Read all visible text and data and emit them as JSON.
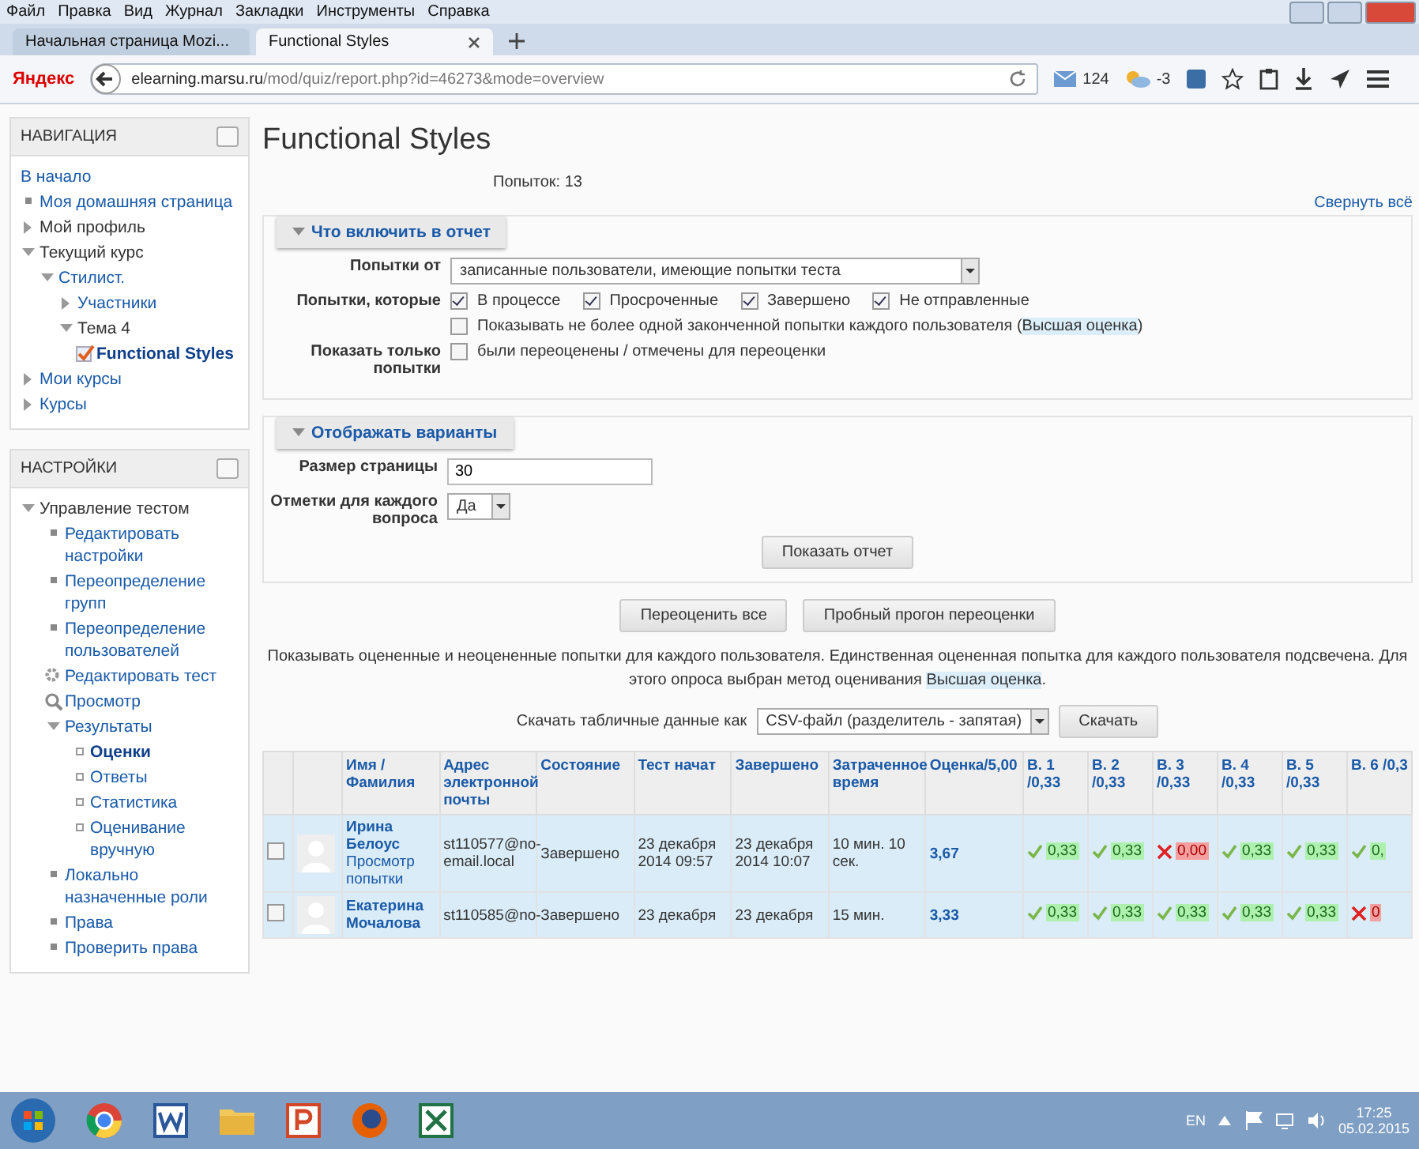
{
  "browser": {
    "menu": [
      "Файл",
      "Правка",
      "Вид",
      "Журнал",
      "Закладки",
      "Инструменты",
      "Справка"
    ],
    "tabs": [
      {
        "title": "Начальная страница Mozi...",
        "selected": false
      },
      {
        "title": "Functional Styles",
        "selected": true
      }
    ],
    "search_engine": "Яндекс",
    "url_host": "elearning.marsu.ru",
    "url_path": "/mod/quiz/report.php?id=46273&mode=overview",
    "mail_count": "124",
    "weather": "-3"
  },
  "navigation": {
    "title": "НАВИГАЦИЯ",
    "items": [
      {
        "label": "В начало",
        "kind": "none",
        "link": true,
        "selected": false
      },
      {
        "label": "Моя домашняя страница",
        "kind": "bullet",
        "link": true,
        "selected": false
      },
      {
        "label": "Мой профиль",
        "kind": "arrow",
        "expanded": false,
        "link": false,
        "selected": false
      },
      {
        "label": "Текущий курс",
        "kind": "arrow",
        "expanded": true,
        "link": false,
        "selected": false,
        "children": [
          {
            "label": "Стилист.",
            "kind": "arrow",
            "expanded": true,
            "link": true,
            "selected": false,
            "children": [
              {
                "label": "Участники",
                "kind": "arrow",
                "expanded": false,
                "link": true,
                "selected": false
              },
              {
                "label": "Тема 4",
                "kind": "arrow",
                "expanded": true,
                "link": false,
                "selected": false,
                "children": [
                  {
                    "label": "Functional Styles",
                    "kind": "quiz",
                    "link": true,
                    "selected": true
                  }
                ]
              }
            ]
          }
        ]
      },
      {
        "label": "Мои курсы",
        "kind": "arrow",
        "expanded": false,
        "link": true,
        "selected": false
      },
      {
        "label": "Курсы",
        "kind": "arrow",
        "expanded": false,
        "link": true,
        "selected": false
      }
    ]
  },
  "settings": {
    "title": "НАСТРОЙКИ",
    "items": [
      {
        "label": "Управление тестом",
        "kind": "arrow",
        "expanded": true,
        "link": false,
        "selected": false,
        "children": [
          {
            "label": "Редактировать настройки",
            "kind": "bullet",
            "link": true,
            "selected": false
          },
          {
            "label": "Переопределение групп",
            "kind": "bullet",
            "link": true,
            "selected": false
          },
          {
            "label": "Переопределение пользователей",
            "kind": "bullet",
            "link": true,
            "selected": false
          },
          {
            "label": "Редактировать тест",
            "kind": "gear",
            "link": true,
            "selected": false
          },
          {
            "label": "Просмотр",
            "kind": "search",
            "link": true,
            "selected": false
          },
          {
            "label": "Результаты",
            "kind": "arrow",
            "expanded": true,
            "link": true,
            "selected": false,
            "children": [
              {
                "label": "Оценки",
                "kind": "square",
                "link": true,
                "selected": true
              },
              {
                "label": "Ответы",
                "kind": "square",
                "link": true,
                "selected": false
              },
              {
                "label": "Статистика",
                "kind": "square",
                "link": true,
                "selected": false
              },
              {
                "label": "Оценивание вручную",
                "kind": "square",
                "link": true,
                "selected": false
              }
            ]
          },
          {
            "label": "Локально назначенные роли",
            "kind": "bullet",
            "link": true,
            "selected": false
          },
          {
            "label": "Права",
            "kind": "bullet",
            "link": true,
            "selected": false
          },
          {
            "label": "Проверить права",
            "kind": "bullet",
            "link": true,
            "selected": false
          }
        ]
      }
    ]
  },
  "page_title": "Functional Styles",
  "attempts_count": "Попыток: 13",
  "collapse_all": "Свернуть всё",
  "report_section": {
    "title": "Что включить в отчет",
    "expanded": true,
    "attempts_from": {
      "label": "Попытки от",
      "value": "записанные пользователи, имеющие попытки теста"
    },
    "attempts_which": {
      "label": "Попытки, которые",
      "options": [
        {
          "label": "В процессе",
          "checked": true
        },
        {
          "label": "Просроченные",
          "checked": true
        },
        {
          "label": "Завершено",
          "checked": true
        },
        {
          "label": "Не отправленные",
          "checked": true
        }
      ]
    },
    "only_one": {
      "checked": false,
      "text": "Показывать не более одной законченной попытки каждого пользователя (",
      "highlight": "Высшая оценка",
      "after": ")"
    },
    "show_only": {
      "label": "Показать только попытки",
      "checked": false,
      "text": "были переоценены / отмечены для переоценки"
    }
  },
  "display_section": {
    "title": "Отображать варианты",
    "expanded": true,
    "page_size": {
      "label": "Размер страницы",
      "value": "30"
    },
    "marks": {
      "label": "Отметки для каждого вопроса",
      "value": "Да"
    },
    "submit": "Показать отчет"
  },
  "actions": [
    "Переоценить все",
    "Пробный прогон переоценки"
  ],
  "info": {
    "text": "Показывать оцененные и неоцененные попытки для каждого пользователя. Единственная оцененная попытка для каждого пользователя подсвечена. Для этого опроса выбран метод оценивания ",
    "highlight": "Высшая оценка",
    "after": "."
  },
  "download": {
    "label": "Скачать табличные данные как",
    "format": "CSV-файл (разделитель - запятая)",
    "button": "Скачать"
  },
  "table": {
    "columns": [
      "Имя / Фамилия",
      "Адрес электронной почты",
      "Состояние",
      "Тест начат",
      "Завершено",
      "Затраченное время",
      "Оценка/5,00",
      "В. 1 /0,33",
      "В. 2 /0,33",
      "В. 3 /0,33",
      "В. 4 /0,33",
      "В. 5 /0,33",
      "В. 6 /0,3"
    ],
    "rows": [
      {
        "selected": true,
        "checked": false,
        "name": "Ирина Белоус",
        "review": "Просмотр попытки",
        "email": "st110577@no-email.local",
        "state": "Завершено",
        "started": "23 декабря 2014 09:57",
        "finished": "23 декабря 2014 10:07",
        "duration": "10 мин. 10 сек.",
        "grade": "3,67",
        "answers": [
          {
            "correct": true,
            "value": "0,33"
          },
          {
            "correct": true,
            "value": "0,33"
          },
          {
            "correct": false,
            "value": "0,00"
          },
          {
            "correct": true,
            "value": "0,33"
          },
          {
            "correct": true,
            "value": "0,33"
          },
          {
            "correct": true,
            "value": "0,"
          }
        ]
      },
      {
        "selected": true,
        "checked": false,
        "name": "Екатерина Мочалова",
        "email": "st110585@no-",
        "state": "Завершено",
        "started": "23 декабря",
        "finished": "23 декабря",
        "duration": "15 мин.",
        "grade": "3,33",
        "answers": [
          {
            "correct": true,
            "value": "0,33"
          },
          {
            "correct": true,
            "value": "0,33"
          },
          {
            "correct": true,
            "value": "0,33"
          },
          {
            "correct": true,
            "value": "0,33"
          },
          {
            "correct": true,
            "value": "0,33"
          },
          {
            "correct": false,
            "value": "0"
          }
        ]
      }
    ]
  },
  "taskbar": {
    "language": "EN",
    "time": "17:25",
    "date": "05.02.2015"
  }
}
